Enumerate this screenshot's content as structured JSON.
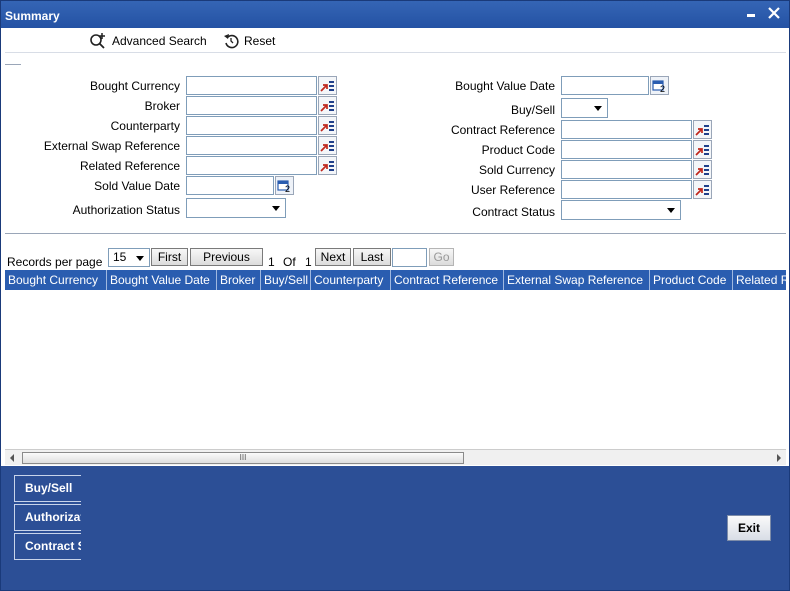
{
  "window": {
    "title": "Summary",
    "minimize": "▬",
    "close": "✕"
  },
  "toolbar": {
    "advanced_search": "Advanced Search",
    "reset": "Reset"
  },
  "criteria": {
    "bought_currency": "Bought Currency",
    "broker": "Broker",
    "counterparty": "Counterparty",
    "external_swap_reference": "External Swap Reference",
    "related_reference": "Related Reference",
    "sold_value_date": "Sold Value Date",
    "authorization_status": "Authorization Status",
    "bought_value_date": "Bought Value Date",
    "buy_sell": "Buy/Sell",
    "contract_reference": "Contract Reference",
    "product_code": "Product Code",
    "sold_currency": "Sold Currency",
    "user_reference": "User Reference",
    "contract_status": "Contract Status"
  },
  "pager": {
    "records_per_page_label": "Records per page",
    "records_per_page": "15",
    "first": "First",
    "previous": "Previous",
    "current_page": "1",
    "of": "Of",
    "total_pages": "1",
    "next": "Next",
    "last": "Last",
    "go": "Go"
  },
  "grid": {
    "columns": [
      "Bought Currency",
      "Bought Value Date",
      "Broker",
      "Buy/Sell",
      "Counterparty",
      "Contract Reference",
      "External Swap Reference",
      "Product Code",
      "Related Reference"
    ]
  },
  "scrollbar": {
    "thumb_grip": "III"
  },
  "footer": {
    "buttons": [
      "Buy/Sell",
      "Authorization Status",
      "Contract Status"
    ],
    "exit": "Exit"
  },
  "colors": {
    "titlebar": "#2452a4",
    "grid_header": "#2a5db0",
    "footer": "#2c4f96"
  }
}
